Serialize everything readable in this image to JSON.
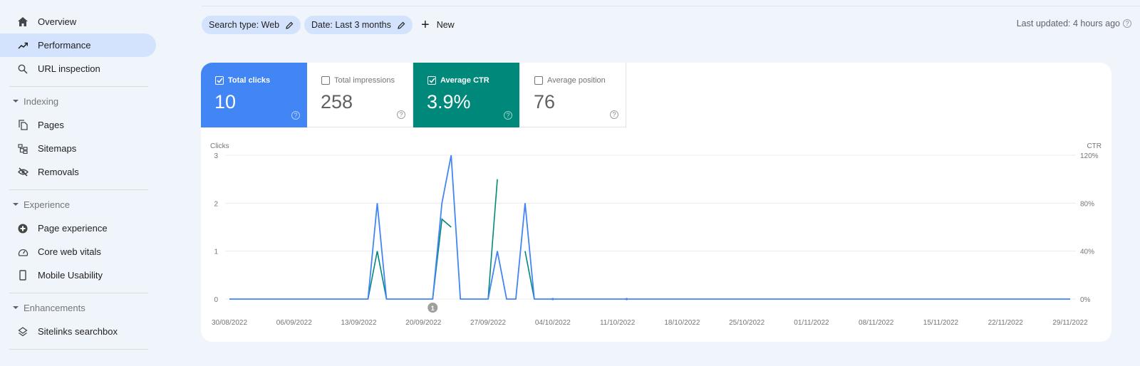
{
  "sidebar": {
    "items": [
      {
        "label": "Overview",
        "icon": "home-icon"
      },
      {
        "label": "Performance",
        "icon": "trending-up-icon",
        "active": true
      },
      {
        "label": "URL inspection",
        "icon": "search-icon"
      }
    ],
    "sections": [
      {
        "label": "Indexing",
        "items": [
          {
            "label": "Pages",
            "icon": "pages-icon"
          },
          {
            "label": "Sitemaps",
            "icon": "sitemap-icon"
          },
          {
            "label": "Removals",
            "icon": "eye-off-icon"
          }
        ]
      },
      {
        "label": "Experience",
        "items": [
          {
            "label": "Page experience",
            "icon": "plus-circle-icon"
          },
          {
            "label": "Core web vitals",
            "icon": "gauge-icon"
          },
          {
            "label": "Mobile Usability",
            "icon": "phone-icon"
          }
        ]
      },
      {
        "label": "Enhancements",
        "items": [
          {
            "label": "Sitelinks searchbox",
            "icon": "layers-icon"
          }
        ]
      }
    ]
  },
  "filters": {
    "search_type": "Search type: Web",
    "date": "Date: Last 3 months",
    "new_label": "New"
  },
  "last_updated": "Last updated: 4 hours ago",
  "metrics": [
    {
      "label": "Total clicks",
      "value": "10",
      "checked": true,
      "color": "#4285f4"
    },
    {
      "label": "Total impressions",
      "value": "258",
      "checked": false
    },
    {
      "label": "Average CTR",
      "value": "3.9%",
      "checked": true,
      "color": "#00897b"
    },
    {
      "label": "Average position",
      "value": "76",
      "checked": false
    }
  ],
  "chart_data": {
    "type": "line",
    "title": "",
    "left_axis_label": "Clicks",
    "right_axis_label": "CTR",
    "left_ticks": [
      "0",
      "1",
      "2",
      "3"
    ],
    "right_ticks": [
      "0%",
      "40%",
      "80%",
      "120%"
    ],
    "ylim_left": [
      0,
      3
    ],
    "ylim_right": [
      0,
      120
    ],
    "x_tick_labels": [
      "30/08/2022",
      "06/09/2022",
      "13/09/2022",
      "20/09/2022",
      "27/09/2022",
      "04/10/2022",
      "11/10/2022",
      "18/10/2022",
      "25/10/2022",
      "01/11/2022",
      "08/11/2022",
      "15/11/2022",
      "22/11/2022",
      "29/11/2022"
    ],
    "x_day_count": 92,
    "grid": true,
    "annotation": {
      "label": "1",
      "day": 22
    },
    "series": [
      {
        "name": "Clicks",
        "axis": "left",
        "color": "#4285f4",
        "points": [
          [
            15,
            0
          ],
          [
            16,
            2
          ],
          [
            17,
            0
          ],
          [
            22,
            0
          ],
          [
            23,
            2
          ],
          [
            24,
            3
          ],
          [
            25,
            0
          ],
          [
            28,
            0
          ],
          [
            29,
            1
          ],
          [
            30,
            0
          ],
          [
            31,
            0
          ],
          [
            32,
            2
          ],
          [
            33,
            0
          ]
        ]
      },
      {
        "name": "CTR",
        "axis": "right",
        "color": "#00897b",
        "segments": [
          [
            [
              15,
              0
            ],
            [
              16,
              40
            ],
            [
              17,
              0
            ]
          ],
          [
            [
              22,
              0
            ],
            [
              23,
              66.7
            ],
            [
              24,
              60
            ]
          ],
          [
            [
              28,
              0
            ],
            [
              29,
              100
            ]
          ],
          [
            [
              32,
              40
            ],
            [
              33,
              0
            ]
          ]
        ]
      }
    ]
  }
}
